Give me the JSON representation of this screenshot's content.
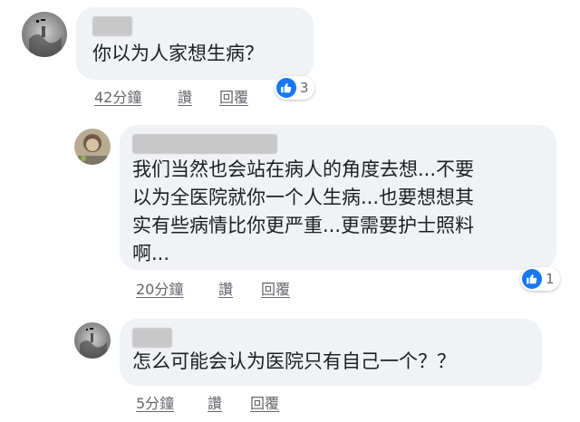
{
  "comments": [
    {
      "text": "你以为人家想生病？",
      "time": "42分鐘",
      "like": "讚",
      "reply": "回覆",
      "reaction_count": "3"
    },
    {
      "text": "我们当然也会站在病人的角度去想...不要\n以为全医院就你一个人生病...也要想想其\n实有些病情比你更严重...更需要护士照料\n啊...",
      "time": "20分鐘",
      "like": "讚",
      "reply": "回覆",
      "reaction_count": "1"
    },
    {
      "text": "怎么可能会认为医院只有自己一个？？",
      "time": "5分鐘",
      "like": "讚",
      "reply": "回覆"
    }
  ],
  "colors": {
    "bubble": "#f0f2f5",
    "like_blue": "#1877f2",
    "meta_gray": "#65676b"
  }
}
